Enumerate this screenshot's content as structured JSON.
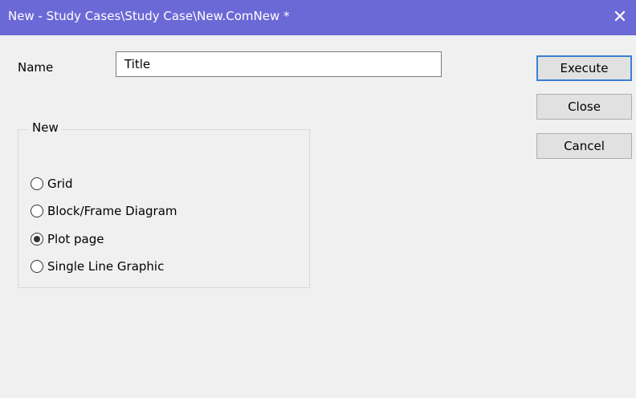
{
  "window": {
    "title": "New - Study Cases\\Study Case\\New.ComNew *",
    "close_glyph": "✕"
  },
  "form": {
    "name_label": "Name",
    "name_value": "Title"
  },
  "buttons": {
    "execute": "Execute",
    "close": "Close",
    "cancel": "Cancel"
  },
  "group": {
    "legend": "New",
    "options": [
      {
        "label": "Grid",
        "selected": false
      },
      {
        "label": "Block/Frame Diagram",
        "selected": false
      },
      {
        "label": "Plot page",
        "selected": true
      },
      {
        "label": "Single Line Graphic",
        "selected": false
      }
    ]
  },
  "colors": {
    "titlebar": "#6b69d6",
    "default_button_border": "#3c7fd0"
  }
}
